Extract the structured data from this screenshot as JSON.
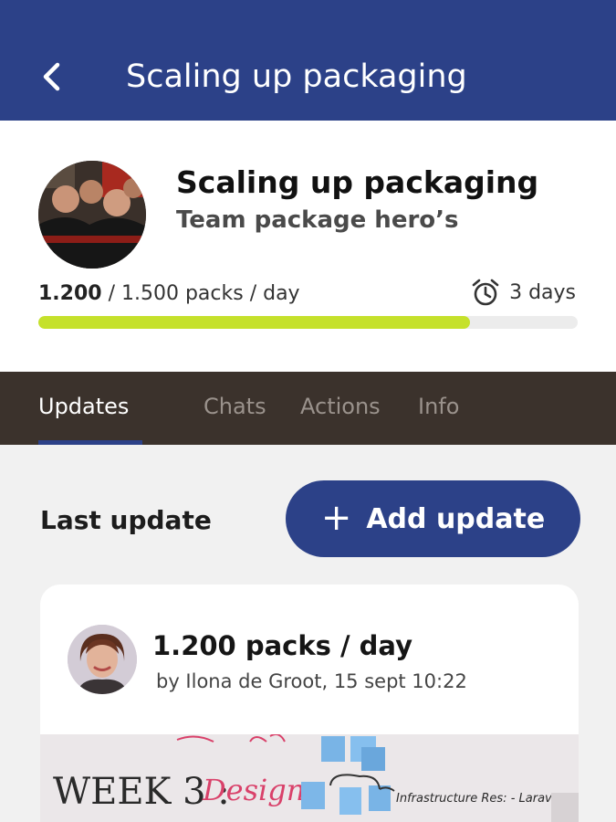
{
  "appbar": {
    "title": "Scaling up packaging",
    "back_icon": "chevron-left-icon",
    "background": "#2c4188"
  },
  "goal": {
    "title": "Scaling up packaging",
    "team": "Team package hero’s",
    "current": "1.200",
    "target_text": " / 1.500 packs / day",
    "progress_fraction": 0.8,
    "deadline_icon": "alarm-clock-icon",
    "deadline": "3 days",
    "progress_color": "#c5e12b"
  },
  "tabs": [
    {
      "label": "Updates",
      "active": true
    },
    {
      "label": "Chats",
      "active": false
    },
    {
      "label": "Actions",
      "active": false
    },
    {
      "label": "Info",
      "active": false
    }
  ],
  "section": {
    "title": "Last update",
    "add_button_icon": "plus-icon",
    "add_button_plus": "+",
    "add_button_label": "Add update"
  },
  "update": {
    "title": "1.200 packs / day",
    "meta": "by Ilona de Groot, 15 sept 10:22",
    "image_text_main": "WEEK 3 :",
    "image_text_accent": "Design",
    "image_text_note": "Infrastructure Res: - Laravel + Backbone"
  },
  "colors": {
    "primary": "#2c4188",
    "tabbar": "#3b322c",
    "background": "#f1f1f1"
  }
}
